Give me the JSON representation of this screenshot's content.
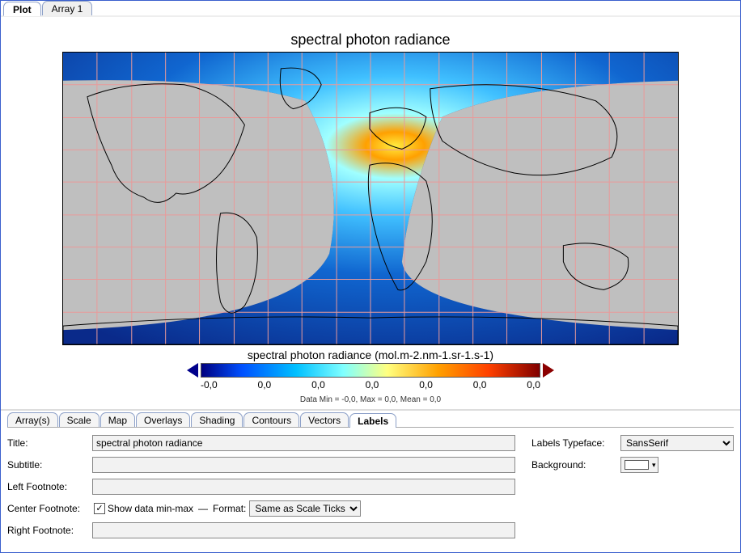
{
  "top_tabs": {
    "plot": "Plot",
    "array1": "Array 1",
    "active": "plot"
  },
  "plot": {
    "title": "spectral photon radiance",
    "colorbar_label": "spectral photon radiance (mol.m-2.nm-1.sr-1.s-1)",
    "colorbar_ticks": [
      "-0,0",
      "0,0",
      "0,0",
      "0,0",
      "0,0",
      "0,0",
      "0,0"
    ],
    "footnote": "Data Min = -0,0, Max = 0,0, Mean = 0,0"
  },
  "option_tabs": {
    "arrays": "Array(s)",
    "scale": "Scale",
    "map": "Map",
    "overlays": "Overlays",
    "shading": "Shading",
    "contours": "Contours",
    "vectors": "Vectors",
    "labels": "Labels",
    "active": "labels"
  },
  "form": {
    "labels": {
      "title": "Title:",
      "subtitle": "Subtitle:",
      "left_footnote": "Left Footnote:",
      "center_footnote": "Center Footnote:",
      "right_footnote": "Right Footnote:",
      "labels_typeface": "Labels Typeface:",
      "background": "Background:",
      "show_minmax": "Show data min-max",
      "format_label": "Format:",
      "separator": "—"
    },
    "values": {
      "title": "spectral photon radiance",
      "subtitle": "",
      "left_footnote": "",
      "right_footnote": "",
      "show_minmax_checked": true,
      "format_selected": "Same as Scale Ticks",
      "typeface_selected": "SansSerif",
      "background_color": "#ffffff"
    }
  }
}
